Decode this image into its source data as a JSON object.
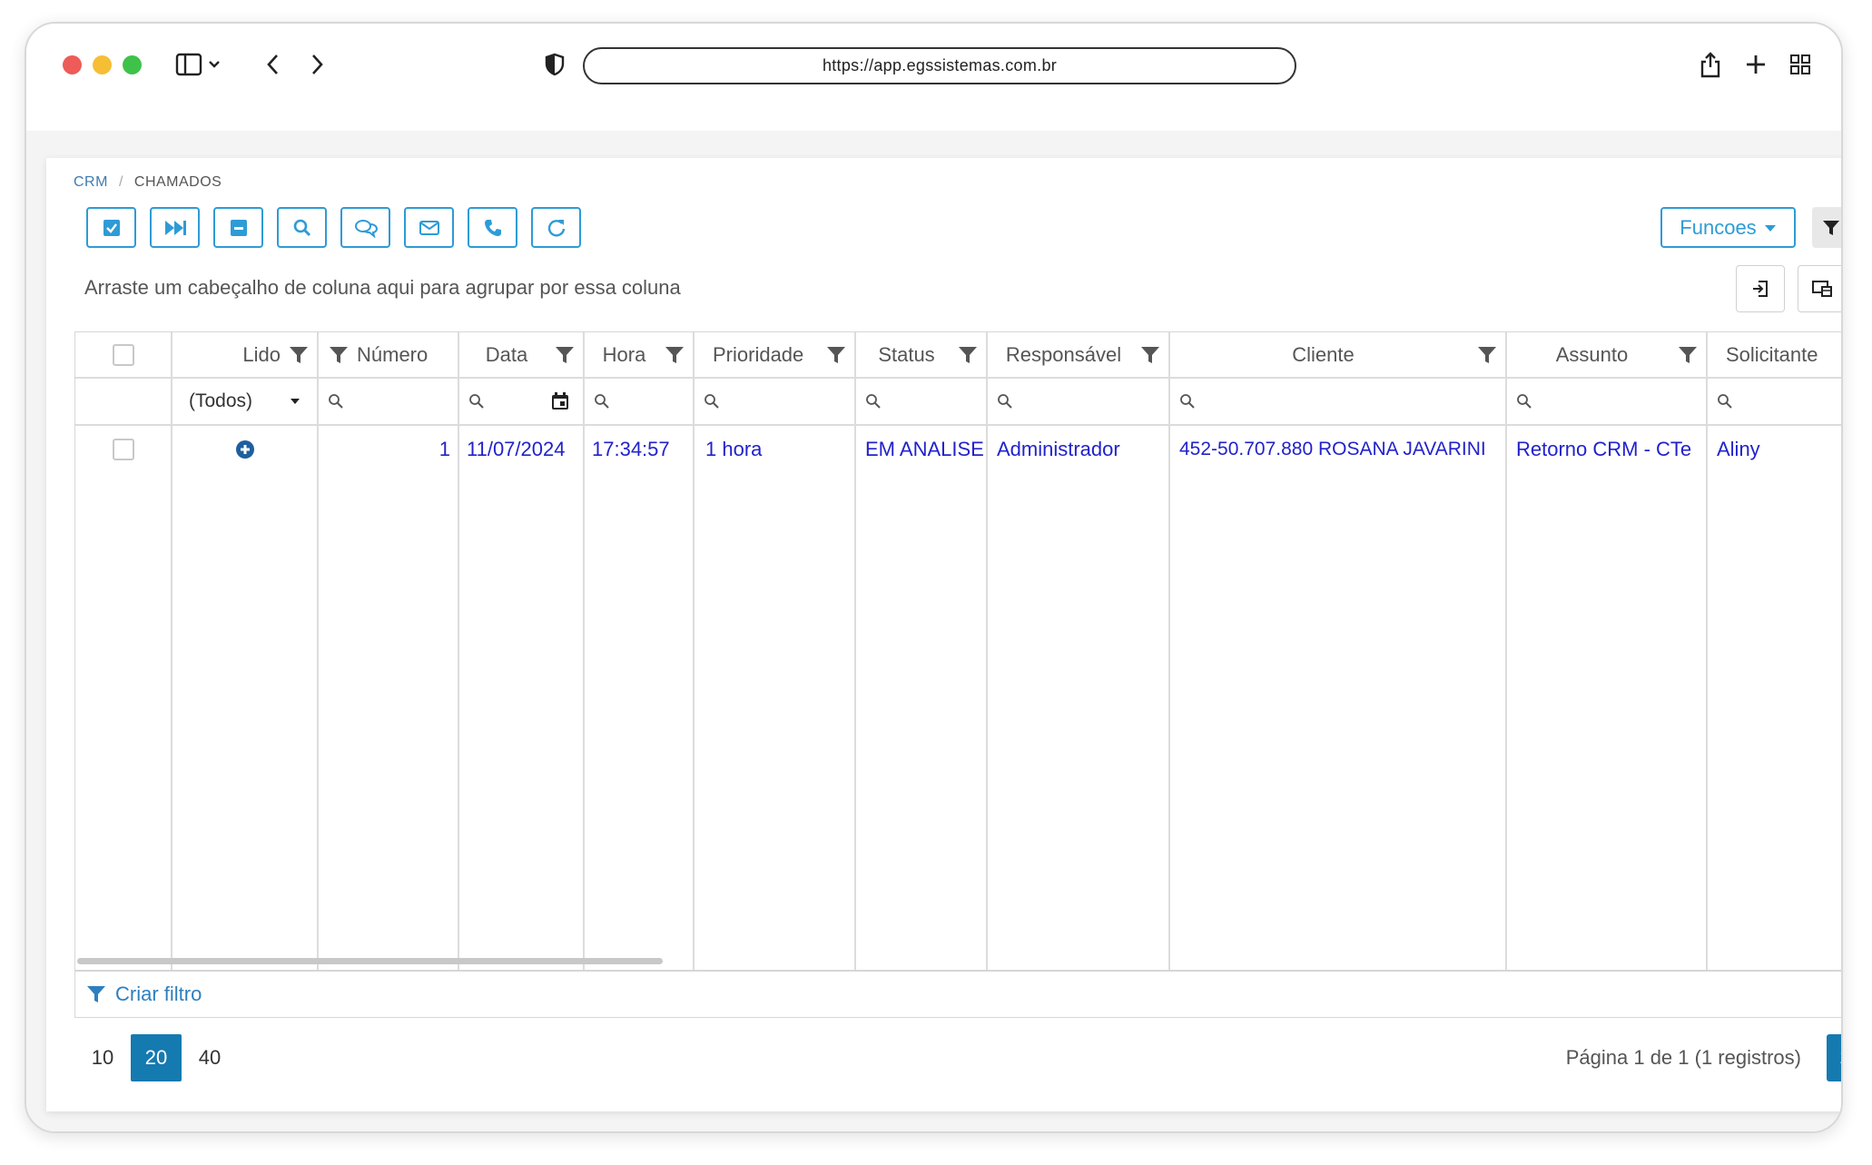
{
  "browser": {
    "url": "https://app.egssistemas.com.br"
  },
  "breadcrumb": {
    "root": "CRM",
    "current": "CHAMADOS"
  },
  "toolbar": {
    "buttons": [
      "check-square-icon",
      "fast-forward-icon",
      "minus-square-icon",
      "search-icon",
      "chat-icon",
      "mail-icon",
      "phone-icon",
      "refresh-icon"
    ],
    "funcoes_label": "Funcoes"
  },
  "group_hint": "Arraste um cabeçalho de coluna aqui para agrupar por essa coluna",
  "grid": {
    "columns": [
      {
        "label": "Lido"
      },
      {
        "label": "Número"
      },
      {
        "label": "Data"
      },
      {
        "label": "Hora"
      },
      {
        "label": "Prioridade"
      },
      {
        "label": "Status"
      },
      {
        "label": "Responsável"
      },
      {
        "label": "Cliente"
      },
      {
        "label": "Assunto"
      },
      {
        "label": "Solicitante"
      }
    ],
    "lido_filter_value": "(Todos)",
    "rows": [
      {
        "numero": "1",
        "data": "11/07/2024",
        "hora": "17:34:57",
        "prioridade": "1 hora",
        "status": "EM ANALISE",
        "responsavel": "Administrador",
        "cliente": "452-50.707.880 ROSANA JAVARINI",
        "assunto": "Retorno CRM - CTe",
        "solicitante": "Aliny"
      }
    ]
  },
  "footer": {
    "create_filter": "Criar filtro"
  },
  "pager": {
    "sizes": [
      "10",
      "20",
      "40"
    ],
    "selected_size": "20",
    "info": "Página 1 de 1 (1 registros)",
    "current_page": "1"
  },
  "colors": {
    "accent": "#2e9bd6",
    "link": "#2222cc",
    "pager_active": "#157ab0"
  }
}
